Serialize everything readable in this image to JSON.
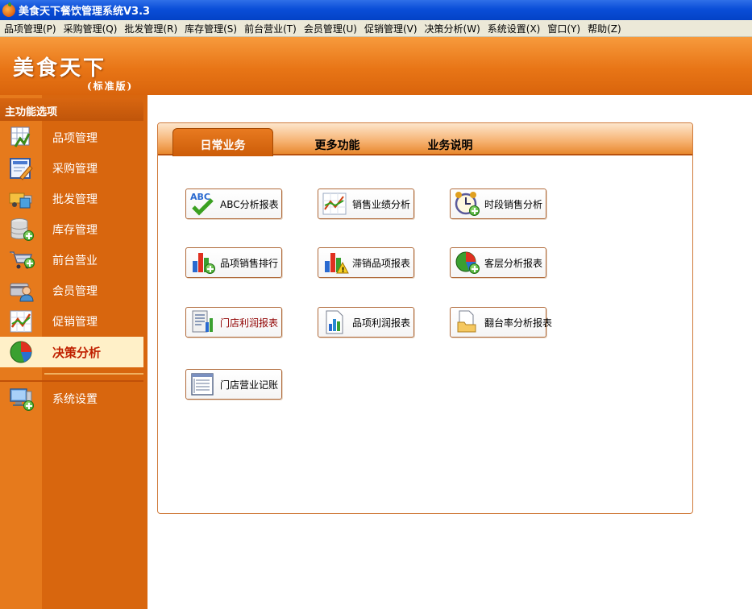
{
  "window": {
    "title": "美食天下餐饮管理系统V3.3"
  },
  "menu": [
    "品项管理(P)",
    "采购管理(Q)",
    "批发管理(R)",
    "库存管理(S)",
    "前台营业(T)",
    "会员管理(U)",
    "促销管理(V)",
    "决策分析(W)",
    "系统设置(X)",
    "窗口(Y)",
    "帮助(Z)"
  ],
  "banner": {
    "logo": "美食天下",
    "edition": "(标准版)"
  },
  "sidebar": {
    "header": "主功能选项",
    "items": [
      {
        "label": "品项管理",
        "icon": "item-management-icon"
      },
      {
        "label": "采购管理",
        "icon": "purchase-icon"
      },
      {
        "label": "批发管理",
        "icon": "wholesale-truck-icon"
      },
      {
        "label": "库存管理",
        "icon": "inventory-database-icon"
      },
      {
        "label": "前台营业",
        "icon": "shopping-cart-icon"
      },
      {
        "label": "会员管理",
        "icon": "member-icon"
      },
      {
        "label": "促销管理",
        "icon": "promotion-chart-icon"
      },
      {
        "label": "决策分析",
        "icon": "pie-chart-icon",
        "active": true
      },
      {
        "label": "系统设置",
        "icon": "computer-settings-icon"
      }
    ]
  },
  "tabs": [
    {
      "label": "日常业务",
      "active": true
    },
    {
      "label": "更多功能",
      "active": false
    },
    {
      "label": "业务说明",
      "active": false
    }
  ],
  "functions": [
    {
      "label": "ABC分析报表",
      "icon": "abc-check-icon"
    },
    {
      "label": "销售业绩分析",
      "icon": "line-chart-icon"
    },
    {
      "label": "时段销售分析",
      "icon": "alarm-clock-icon"
    },
    {
      "label": "品项销售排行",
      "icon": "bar-chart-plus-icon"
    },
    {
      "label": "滞销品项报表",
      "icon": "bar-chart-warning-icon"
    },
    {
      "label": "客层分析报表",
      "icon": "pie-chart-plus-icon"
    },
    {
      "label": "门店利润报表",
      "icon": "report-bars-icon"
    },
    {
      "label": "品项利润报表",
      "icon": "document-bars-icon"
    },
    {
      "label": "翻台率分析报表",
      "icon": "folder-document-icon"
    },
    {
      "label": "门店营业记账",
      "icon": "ledger-window-icon"
    }
  ],
  "colors": {
    "accent": "#e87516",
    "active_text": "#c02000",
    "titlebar": "#0a4ed8"
  }
}
